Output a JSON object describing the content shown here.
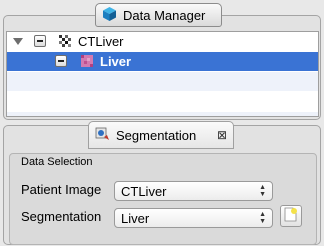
{
  "data_manager": {
    "title": "Data Manager",
    "nodes": [
      {
        "label": "CTLiver",
        "selected": false
      },
      {
        "label": "Liver",
        "selected": true
      }
    ]
  },
  "segmentation": {
    "title": "Segmentation",
    "group_title": "Data Selection",
    "patient_image_label": "Patient Image",
    "patient_image_value": "CTLiver",
    "segmentation_label": "Segmentation",
    "segmentation_value": "Liver"
  },
  "colors": {
    "selection": "#3a73d4",
    "stripe": "#eef2fa"
  },
  "icons": {
    "data_manager_tab": "cube-icon",
    "segmentation_tab": "segmentation-icon",
    "close": "close-icon",
    "new_segmentation": "new-document-icon"
  }
}
